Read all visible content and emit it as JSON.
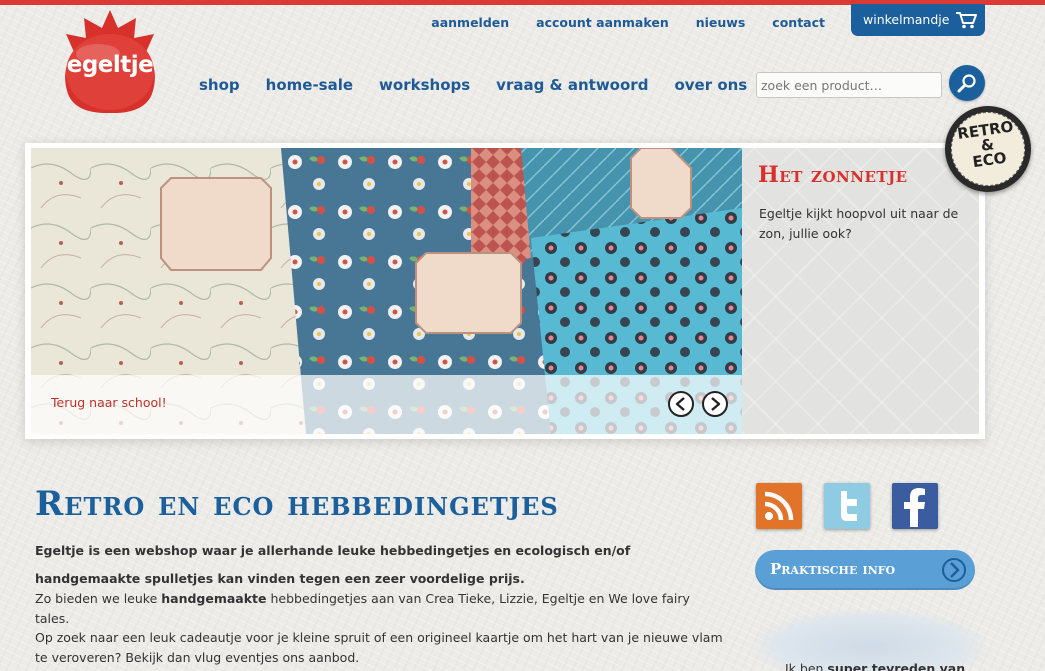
{
  "brand": {
    "logo_text": "egeltje",
    "accent_red": "#d93b34",
    "accent_blue": "#1b5f9c"
  },
  "top_links": [
    "aanmelden",
    "account aanmaken",
    "nieuws",
    "contact"
  ],
  "cart": {
    "label": "winkelmandje",
    "icon": "cart-icon"
  },
  "main_nav": [
    "shop",
    "home-sale",
    "workshops",
    "vraag & antwoord",
    "over ons"
  ],
  "search": {
    "placeholder": "zoek een product…",
    "icon": "search-icon"
  },
  "badge": {
    "line1": "RETRO",
    "line2": "&",
    "line3": "ECO"
  },
  "slider": {
    "caption": "Terug naar school!",
    "panel_title": "Het zonnetje",
    "panel_text": "Egeltje kijkt hoopvol uit naar de zon, jullie ook?",
    "prev_icon": "arrow-left-icon",
    "next_icon": "arrow-right-icon"
  },
  "content": {
    "heading": "Retro en eco hebbedingetjes",
    "intro": "Egeltje is een webshop waar je allerhande leuke hebbedingetjes en ecologisch en/of handgemaakte spulletjes kan vinden tegen een zeer voordelige prijs.",
    "para1_start": "Zo bieden we leuke ",
    "para1_bold": "handgemaakte",
    "para1_end": " hebbedingetjes aan van Crea Tieke, Lizzie, Egeltje en We love fairy tales.",
    "para2": "Op zoek naar een leuk cadeautje voor je kleine spruit of een origineel kaartje om het hart van je nieuwe vlam te veroveren? Bekijk dan vlug eventjes ons aanbod."
  },
  "sidebar": {
    "social": [
      "rss-icon",
      "twitter-icon",
      "facebook-icon"
    ],
    "info_button": "Praktische info",
    "review_start": "Ik ben ",
    "review_bold": "super tevreden van"
  }
}
